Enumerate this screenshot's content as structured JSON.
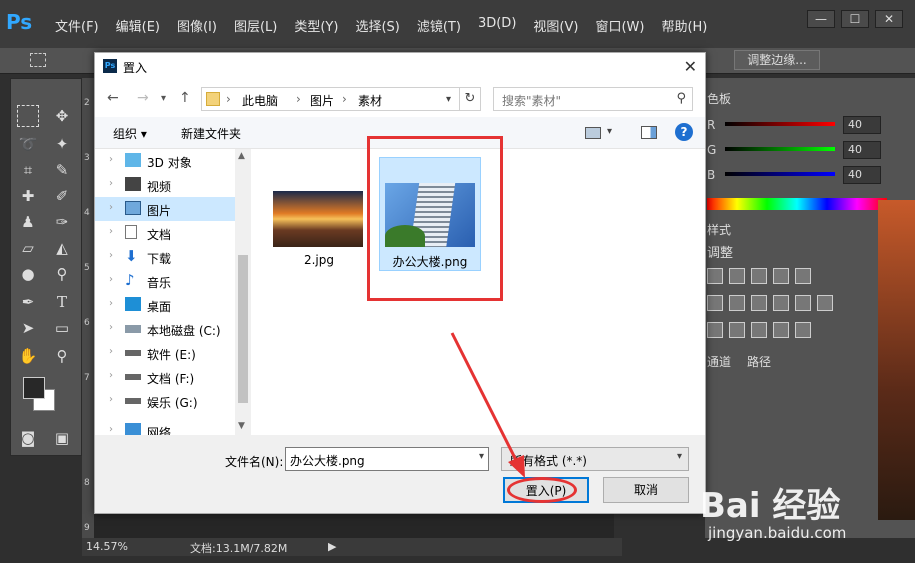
{
  "app": {
    "logo": "Ps",
    "menu": [
      "文件(F)",
      "编辑(E)",
      "图像(I)",
      "图层(L)",
      "类型(Y)",
      "选择(S)",
      "滤镜(T)",
      "3D(D)",
      "视图(V)",
      "窗口(W)",
      "帮助(H)"
    ],
    "window_controls": [
      "—",
      "☐",
      "✕"
    ],
    "options": {
      "refine_edge": "调整边缘..."
    },
    "status": {
      "zoom": "14.57%",
      "doc": "文档:13.1M/7.82M"
    },
    "ruler_marks": [
      "2",
      "3",
      "4",
      "5",
      "6",
      "7",
      "8",
      "9"
    ]
  },
  "right_panel": {
    "color_title": "色板",
    "rgb": [
      {
        "channel": "R",
        "value": "40"
      },
      {
        "channel": "G",
        "value": "40"
      },
      {
        "channel": "B",
        "value": "40"
      }
    ],
    "styles_title": "样式",
    "adjust_title": "调整",
    "tabs": [
      "通道",
      "路径"
    ]
  },
  "dialog": {
    "title": "置入",
    "breadcrumb": [
      "此电脑",
      "图片",
      "素材"
    ],
    "search_placeholder": "搜索\"素材\"",
    "organize": "组织 ▾",
    "new_folder": "新建文件夹",
    "help": "?",
    "nav": [
      {
        "label": "3D 对象",
        "icon": "cube-icon"
      },
      {
        "label": "视频",
        "icon": "video-icon"
      },
      {
        "label": "图片",
        "icon": "pictures-icon",
        "selected": true
      },
      {
        "label": "文档",
        "icon": "document-icon"
      },
      {
        "label": "下载",
        "icon": "download-icon"
      },
      {
        "label": "音乐",
        "icon": "music-icon"
      },
      {
        "label": "桌面",
        "icon": "desktop-icon"
      },
      {
        "label": "本地磁盘 (C:)",
        "icon": "drive-icon"
      },
      {
        "label": "软件 (E:)",
        "icon": "drive-icon"
      },
      {
        "label": "文档 (F:)",
        "icon": "drive-icon"
      },
      {
        "label": "娱乐 (G:)",
        "icon": "drive-icon"
      },
      {
        "label": "网络",
        "icon": "network-icon"
      }
    ],
    "files": [
      {
        "name": "2.jpg",
        "selected": false
      },
      {
        "name": "办公大楼.png",
        "selected": true
      }
    ],
    "filename_label": "文件名(N):",
    "filename_value": "办公大楼.png",
    "filetype_value": "所有格式 (*.*)",
    "place_button": "置入(P)",
    "cancel_button": "取消"
  },
  "watermark": {
    "brand": "Bai 经验",
    "url": "jingyan.baidu.com"
  }
}
